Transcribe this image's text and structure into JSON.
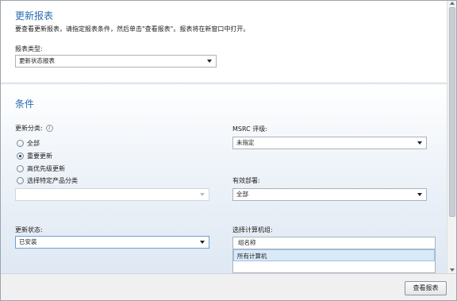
{
  "report": {
    "title": "更新报表",
    "description": "要查看更新报表，请指定报表条件，然后单击\"查看报表\"。报表将在新窗口中打开。",
    "type_label": "报表类型:",
    "type_value": "更新状态报表"
  },
  "conditions": {
    "title": "条件",
    "category_label": "更新分类:",
    "category_options": [
      {
        "label": "全部",
        "checked": false
      },
      {
        "label": "重要更新",
        "checked": true
      },
      {
        "label": "高优先级更新",
        "checked": false
      },
      {
        "label": "选择特定产品分类",
        "checked": false
      }
    ],
    "product_select_value": "",
    "msrc_label": "MSRC 评级:",
    "msrc_value": "未指定",
    "deployment_label": "有效部署:",
    "deployment_value": "全部",
    "status_label": "更新状态:",
    "status_value": "已安装",
    "computer_group_label": "选择计算机组:",
    "group_column_header": "组名称",
    "groups": [
      "所有计算机"
    ]
  },
  "footer": {
    "view_report_label": "查看报表"
  }
}
